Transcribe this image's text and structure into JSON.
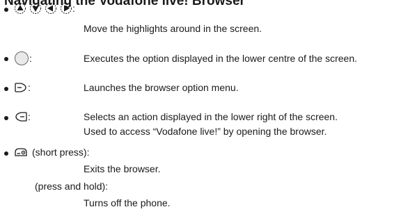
{
  "heading": "Navigating the Vodafone live! Browser",
  "items": [
    {
      "keys": [
        "up-key-icon",
        "down-key-icon",
        "left-key-icon",
        "right-key-icon"
      ],
      "colon": ":",
      "desc": [
        "Move the highlights around in the screen."
      ]
    },
    {
      "keys": [
        "centre-key-icon"
      ],
      "colon": ":",
      "desc": [
        "Executes the option displayed in the lower centre of the screen."
      ]
    },
    {
      "keys": [
        "left-soft-key-icon"
      ],
      "colon": ":",
      "desc": [
        "Launches the browser option menu."
      ]
    },
    {
      "keys": [
        "right-soft-key-icon"
      ],
      "colon": ":",
      "desc": [
        "Selects an action displayed in the lower right of the screen.",
        "Used to access “Vodafone live!” by opening the browser."
      ]
    },
    {
      "keys": [
        "end-key-icon"
      ],
      "short_press": "(short press):",
      "short_desc": "Exits the browser.",
      "hold_press": "(press and hold):",
      "hold_desc": "Turns off the phone."
    }
  ]
}
